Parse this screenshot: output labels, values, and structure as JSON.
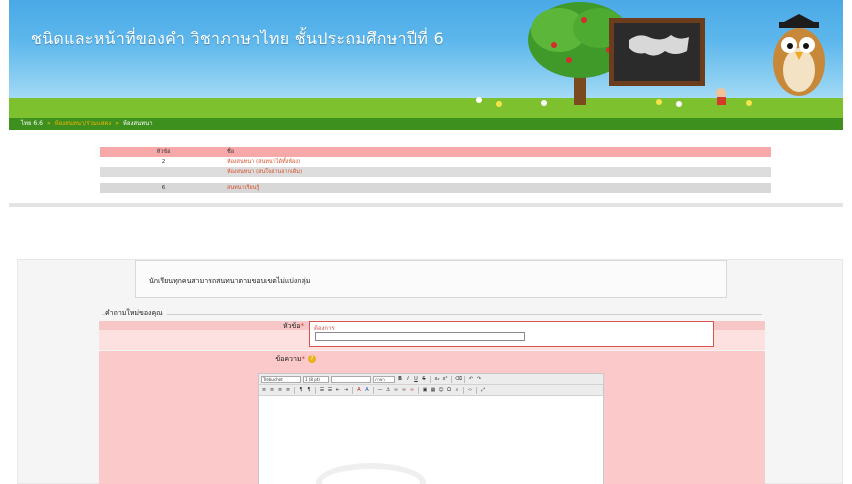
{
  "header": {
    "title": "ชนิดและหน้าที่ของคำ วิชาภาษาไทย ชั้นประถมศึกษาปีที่ 6"
  },
  "breadcrumb": {
    "items": [
      "ไทย 6.6",
      "ห้องสนทนา/ร่วมแสดง",
      "ห้องสนทนา"
    ]
  },
  "topics": {
    "headers": [
      "หัวข้อ",
      "ชื่อ"
    ],
    "rows": [
      {
        "count": "2",
        "name": "ห้องสนทนา (สนทนาได้ทั้งห้อง)"
      },
      {
        "count": "",
        "name": "ห้องสนทนา (สนใจอ่านจากเดิม)"
      },
      {
        "count": "6",
        "name": "สนทนาเรียนรู้"
      }
    ]
  },
  "lower": {
    "notice": "นักเรียนทุกคนสามารถสนทนาตามขอบเขตไม่แบ่งกลุ่ม",
    "legend": "คำถามใหม่ของคุณ",
    "subject_label": "หัวข้อ",
    "required_mark": "*",
    "subject_hint": "ต้องการ",
    "subject_value": "",
    "message_label": "ข้อความ",
    "help_icon_glyph": "?",
    "editor": {
      "font_family": "Trebuchet",
      "font_size": "1 (8 pt)",
      "style": "",
      "lang": "ภาษา"
    }
  },
  "colors": {
    "banner_sky": "#4aa9e6",
    "grass": "#7ec12f",
    "crumb_bar": "#3d8f1e",
    "table_header": "#f7a8a8",
    "form_pink": "#fbc9c9",
    "required_red": "#d9342b"
  }
}
